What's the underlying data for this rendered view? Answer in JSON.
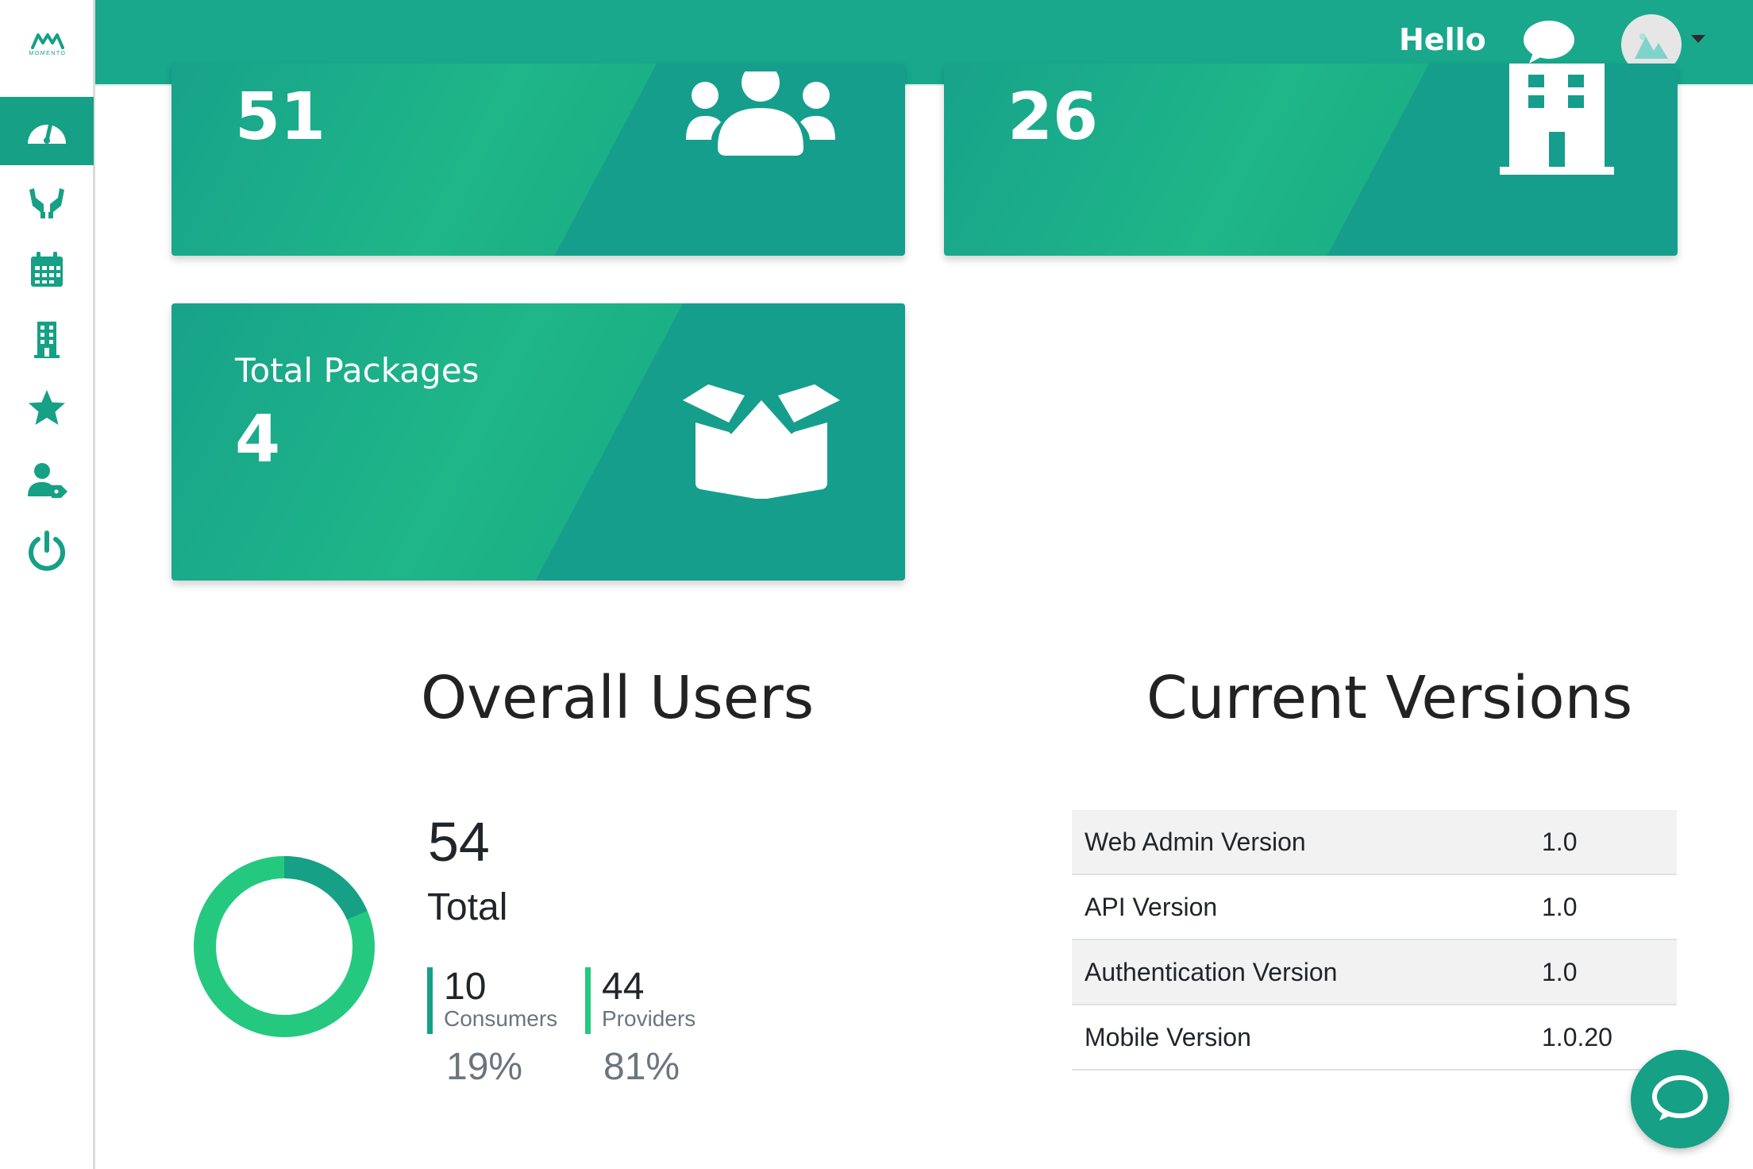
{
  "brand": {
    "logo_text": "MOMENTO",
    "accent": "#16a085",
    "header_bg": "#19a88c"
  },
  "sidebar": {
    "items": [
      {
        "icon": "dashboard-gauge-icon",
        "active": true
      },
      {
        "icon": "hands-icon"
      },
      {
        "icon": "calendar-icon"
      },
      {
        "icon": "building-icon"
      },
      {
        "icon": "star-icon"
      },
      {
        "icon": "user-tag-icon"
      },
      {
        "icon": "power-icon"
      }
    ]
  },
  "header": {
    "greeting": "Hello",
    "chat_icon": "chat-bubble-icon",
    "avatar_icon": "image-placeholder-icon"
  },
  "cards": [
    {
      "value": "51",
      "icon": "users-icon"
    },
    {
      "value": "26",
      "icon": "building-icon"
    },
    {
      "label": "Total Packages",
      "value": "4",
      "icon": "open-box-icon"
    }
  ],
  "overall_users": {
    "title": "Overall Users",
    "total": "54",
    "total_label": "Total",
    "consumers": {
      "count": "10",
      "label": "Consumers",
      "percent": "19%",
      "color": "#16a085"
    },
    "providers": {
      "count": "44",
      "label": "Providers",
      "percent": "81%",
      "color": "#24c97f"
    }
  },
  "versions": {
    "title": "Current Versions",
    "rows": [
      {
        "name": "Web Admin Version",
        "value": "1.0"
      },
      {
        "name": "API Version",
        "value": "1.0"
      },
      {
        "name": "Authentication Version",
        "value": "1.0"
      },
      {
        "name": "Mobile Version",
        "value": "1.0.20"
      }
    ]
  },
  "fab": {
    "icon": "chat-bubble-icon"
  }
}
